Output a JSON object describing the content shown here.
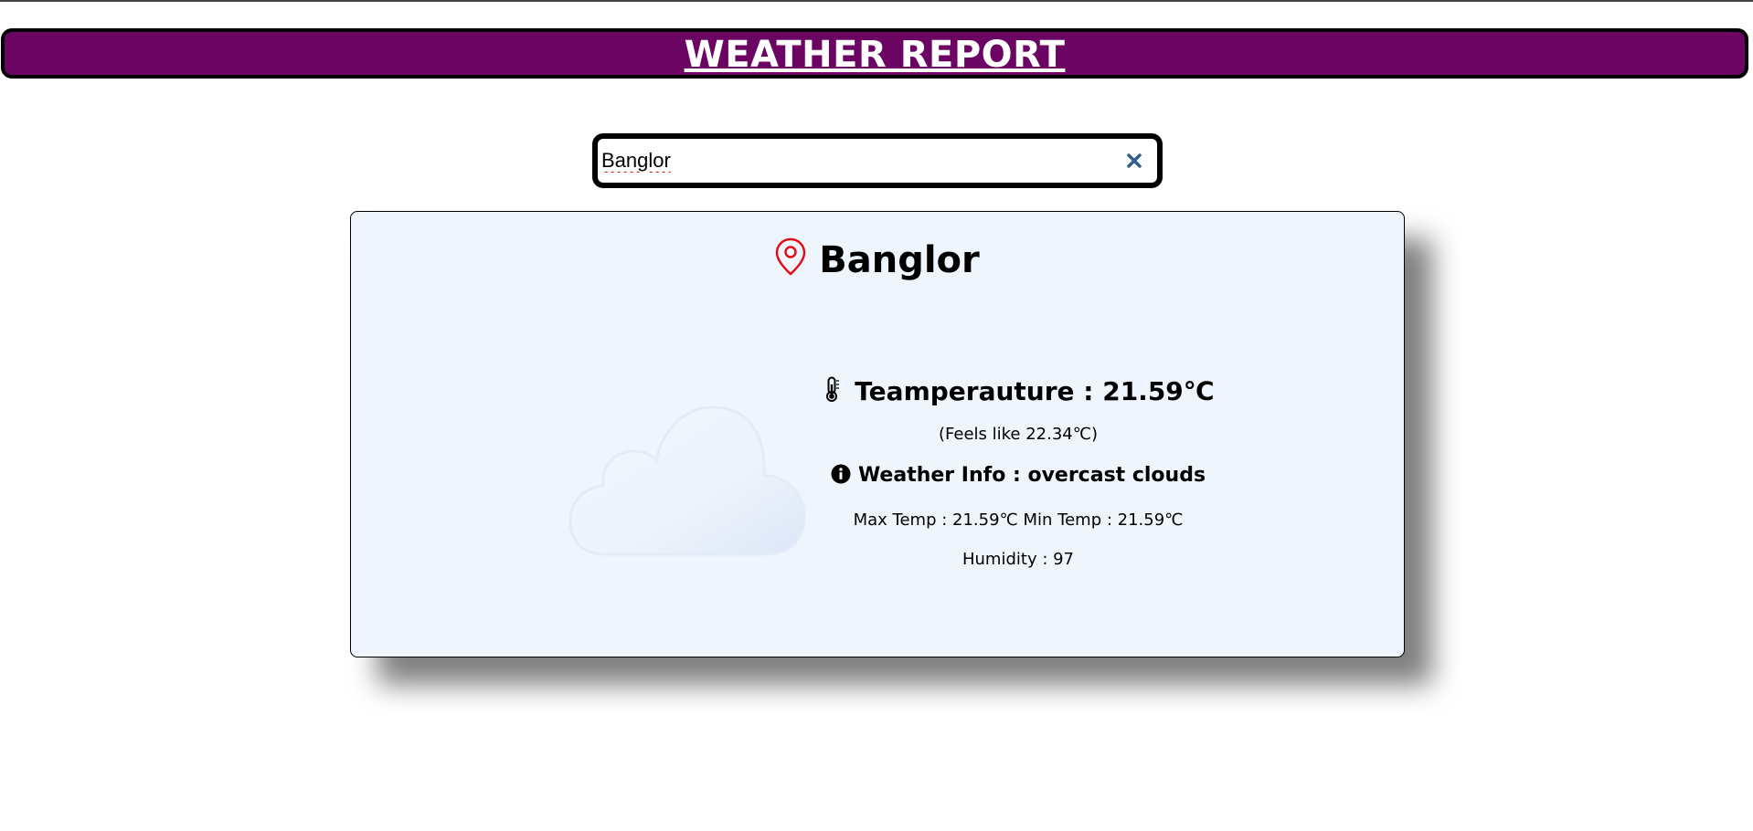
{
  "header": {
    "title": "WEATHER REPORT"
  },
  "search": {
    "value": "Banglor",
    "clear_icon": "close-icon"
  },
  "card": {
    "city": "Banglor",
    "location_icon": "map-pin-icon",
    "weather_icon": "cloud-icon",
    "temperature": "Teamperauture : 21.59℃",
    "feels_like": "(Feels like 22.34℃)",
    "weather_info": "Weather Info : overcast clouds",
    "min_max": "Max Temp : 21.59℃ Min Temp : 21.59℃",
    "humidity": "Humidity : 97"
  },
  "colors": {
    "banner": "#6b0463",
    "card_bg": "#eef5fd",
    "pin": "#e0101a",
    "clear_icon": "#2f5f8a"
  }
}
